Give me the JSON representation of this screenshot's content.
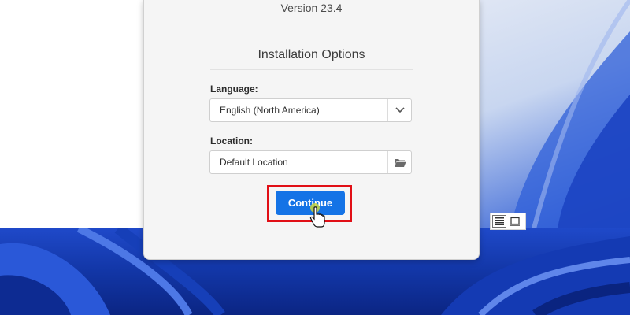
{
  "dialog": {
    "version": "Version 23.4",
    "section_title": "Installation Options",
    "language": {
      "label": "Language:",
      "value": "English (North America)",
      "dropdown_icon": "chevron-down-icon"
    },
    "location": {
      "label": "Location:",
      "value": "Default Location",
      "browse_icon": "folder-icon"
    },
    "continue_label": "Continue"
  },
  "view_toggle": {
    "icons": [
      "details-view-icon",
      "preview-view-icon"
    ]
  },
  "colors": {
    "accent": "#1473e6",
    "highlight": "#e10f16",
    "wallpaper": "#1f49c9"
  }
}
